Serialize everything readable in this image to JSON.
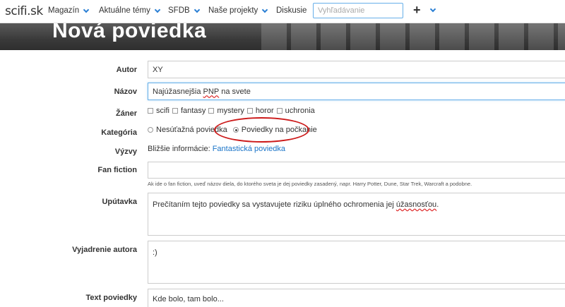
{
  "nav": {
    "logo": "scifi.sk",
    "items": [
      "Magazín",
      "Aktuálne témy",
      "SFDB",
      "Naše projekty",
      "Diskusie"
    ],
    "search_placeholder": "Vyhľadávanie",
    "plus": "+"
  },
  "banner": {
    "title": "Nová poviedka"
  },
  "form": {
    "autor": {
      "label": "Autor",
      "value": "XY"
    },
    "nazov": {
      "label": "Názov",
      "value_pre": "Najúžasnejšia ",
      "value_spell": "PNP",
      "value_post": " na svete"
    },
    "zaner": {
      "label": "Žáner",
      "options": [
        "scifi",
        "fantasy",
        "mystery",
        "horor",
        "uchronia"
      ]
    },
    "kategoria": {
      "label": "Kategória",
      "options": [
        "Nesúťažná poviedka",
        "Poviedky na počkanie"
      ],
      "selected": "Poviedky na počkanie"
    },
    "vyzvy": {
      "label": "Výzvy",
      "text": "Bližšie informácie:",
      "link": "Fantastická poviedka"
    },
    "fan_fiction": {
      "label": "Fan fiction",
      "hint": "Ak ide o fan fiction, uveď názov diela, do ktorého sveta je dej poviedky zasadený, napr. Harry Potter, Dune, Star Trek, Warcraft a podobne."
    },
    "uputavka": {
      "label": "Upútavka",
      "value_pre": "Prečítaním tejto poviedky sa vystavujete riziku úplného ochromenia jej ",
      "value_spell": "úžasnosťou",
      "value_post": "."
    },
    "vyjadrenie": {
      "label": "Vyjadrenie autora",
      "value": ":)"
    },
    "text": {
      "label": "Text poviedky",
      "value": "Kde bolo, tam bolo..."
    }
  },
  "colors": {
    "accent": "#2a7fd4",
    "annotation": "#cc1a1a",
    "link": "#1a74c8"
  }
}
